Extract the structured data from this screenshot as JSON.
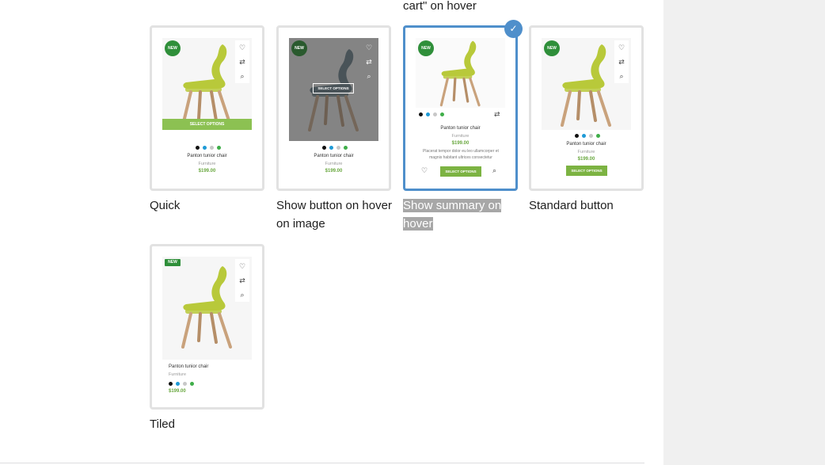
{
  "header": {
    "partial_text": "cart\" on hover"
  },
  "colors": {
    "accent": "#4f8fcb",
    "green": "#7cb342",
    "badge": "#2f8f3a",
    "price": "#6aa840"
  },
  "product": {
    "name": "Panton tunior chair",
    "category": "Furniture",
    "price": "$199.00",
    "badge": "NEW",
    "select_label": "SELECT OPTIONS",
    "description": "Placerat tempor dolor eu leo ullamcorper et magnis habitant ultrices consectetur",
    "swatches": [
      "#111111",
      "#1e9ad6",
      "#c8c8c8",
      "#3fae49"
    ]
  },
  "options": [
    {
      "caption": "Quick",
      "selected": false
    },
    {
      "caption": "Show button on hover on image",
      "selected": false
    },
    {
      "caption": "Show summary on hover",
      "selected": true
    },
    {
      "caption": "Standard button",
      "selected": false
    },
    {
      "caption": "Tiled",
      "selected": false
    }
  ]
}
